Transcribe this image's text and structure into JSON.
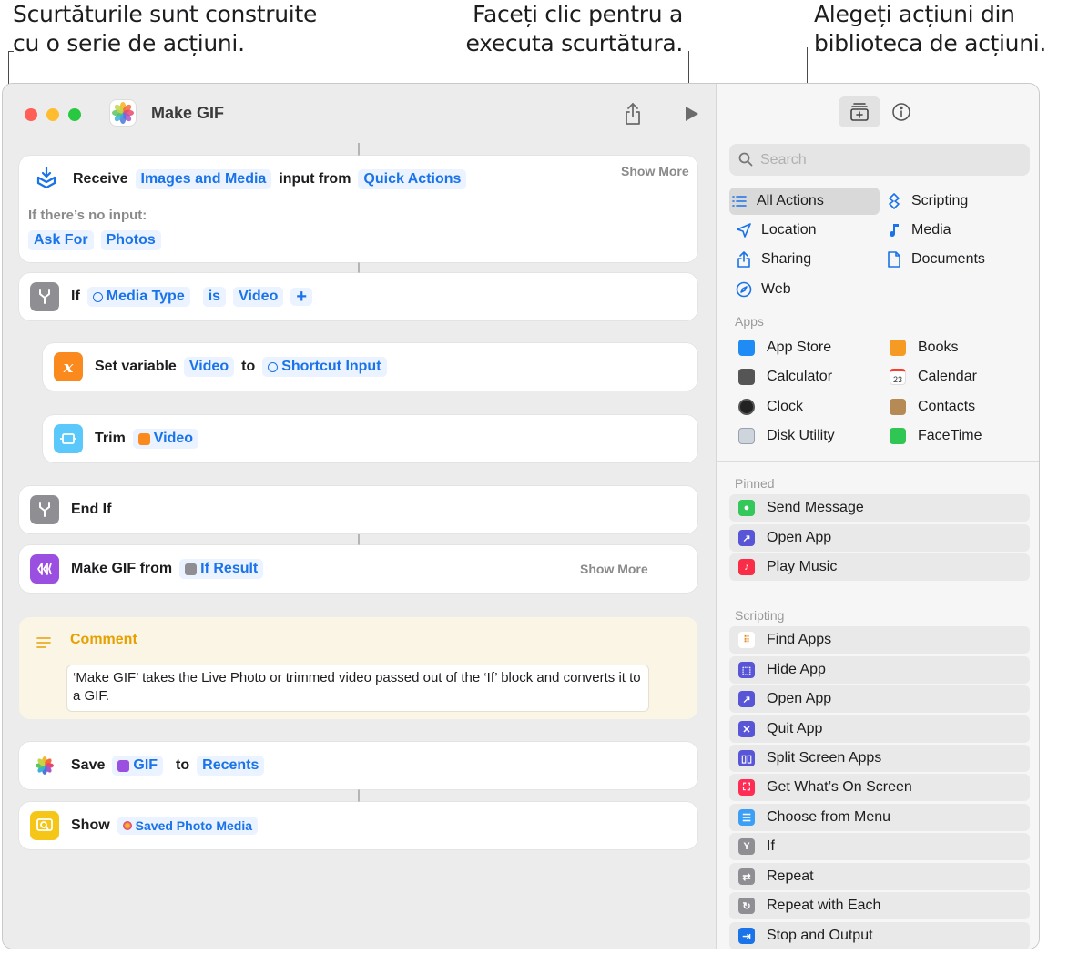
{
  "callouts": {
    "left": [
      "Scurtăturile sunt construite",
      "cu o serie de acțiuni."
    ],
    "middle": [
      "Faceți clic pentru a",
      "executa scurtătura."
    ],
    "right": [
      "Alegeți acțiuni din",
      "biblioteca de acțiuni."
    ]
  },
  "window": {
    "title": "Make GIF"
  },
  "actions": {
    "receive": {
      "verb": "Receive",
      "type": "Images and Media",
      "mid": "input from",
      "source": "Quick Actions",
      "show_more": "Show More",
      "no_input_label": "If there’s no input:",
      "ask_for": "Ask For",
      "photos": "Photos"
    },
    "if": {
      "verb": "If",
      "var": "Media Type",
      "op": "is",
      "value": "Video",
      "add": "+"
    },
    "set_var": {
      "verb": "Set variable",
      "name": "Video",
      "to": "to",
      "value": "Shortcut Input"
    },
    "trim": {
      "verb": "Trim",
      "value": "Video"
    },
    "end_if": {
      "verb": "End If"
    },
    "make_gif": {
      "verb": "Make GIF from",
      "value": "If Result",
      "show_more": "Show More"
    },
    "comment": {
      "title": "Comment",
      "text": "‘Make GIF’ takes the Live Photo or trimmed video passed out of the ‘If’ block and converts it to a GIF."
    },
    "save": {
      "verb": "Save",
      "value": "GIF",
      "to": "to",
      "album": "Recents"
    },
    "show": {
      "verb": "Show",
      "value": "Saved Photo Media"
    }
  },
  "library": {
    "search_placeholder": "Search",
    "categories": [
      {
        "label": "All Actions",
        "icon": "list-icon",
        "selected": true
      },
      {
        "label": "Scripting",
        "icon": "scripting-icon"
      },
      {
        "label": "Location",
        "icon": "location-arrow-icon"
      },
      {
        "label": "Media",
        "icon": "music-note-icon"
      },
      {
        "label": "Sharing",
        "icon": "share-icon"
      },
      {
        "label": "Documents",
        "icon": "document-icon"
      },
      {
        "label": "Web",
        "icon": "compass-icon"
      }
    ],
    "apps_label": "Apps",
    "apps": [
      {
        "label": "App Store",
        "color": "#1f8bf5"
      },
      {
        "label": "Books",
        "color": "#f59b23"
      },
      {
        "label": "Calculator",
        "color": "#555555"
      },
      {
        "label": "Calendar",
        "color": "#ffffff"
      },
      {
        "label": "Clock",
        "color": "#222222"
      },
      {
        "label": "Contacts",
        "color": "#b58a55"
      },
      {
        "label": "Disk Utility",
        "color": "#9aa3ad"
      },
      {
        "label": "FaceTime",
        "color": "#2fc653"
      }
    ],
    "calendar_day": "23",
    "pinned_label": "Pinned",
    "pinned": [
      {
        "label": "Send Message",
        "color": "#34c759",
        "icon": "message-bubble-icon"
      },
      {
        "label": "Open App",
        "color": "#5856d6",
        "icon": "arrow-up-right-icon"
      },
      {
        "label": "Play Music",
        "color": "#fa2d48",
        "icon": "music-note-icon"
      }
    ],
    "scripting_label": "Scripting",
    "scripting": [
      {
        "label": "Find Apps",
        "color": "#ffffff",
        "icon": "app-grid-icon"
      },
      {
        "label": "Hide App",
        "color": "#5856d6",
        "icon": "dashed-square-icon"
      },
      {
        "label": "Open App",
        "color": "#5856d6",
        "icon": "arrow-up-right-icon"
      },
      {
        "label": "Quit App",
        "color": "#5856d6",
        "icon": "x-square-icon"
      },
      {
        "label": "Split Screen Apps",
        "color": "#5856d6",
        "icon": "split-screen-icon"
      },
      {
        "label": "Get What’s On Screen",
        "color": "#ff2d55",
        "icon": "screen-scan-icon"
      },
      {
        "label": "Choose from Menu",
        "color": "#3a9ff5",
        "icon": "menu-icon"
      },
      {
        "label": "If",
        "color": "#8e8e93",
        "icon": "branch-icon"
      },
      {
        "label": "Repeat",
        "color": "#8e8e93",
        "icon": "repeat-icon"
      },
      {
        "label": "Repeat with Each",
        "color": "#8e8e93",
        "icon": "repeat-each-icon"
      },
      {
        "label": "Stop and Output",
        "color": "#1a73e8",
        "icon": "exit-icon"
      }
    ]
  }
}
